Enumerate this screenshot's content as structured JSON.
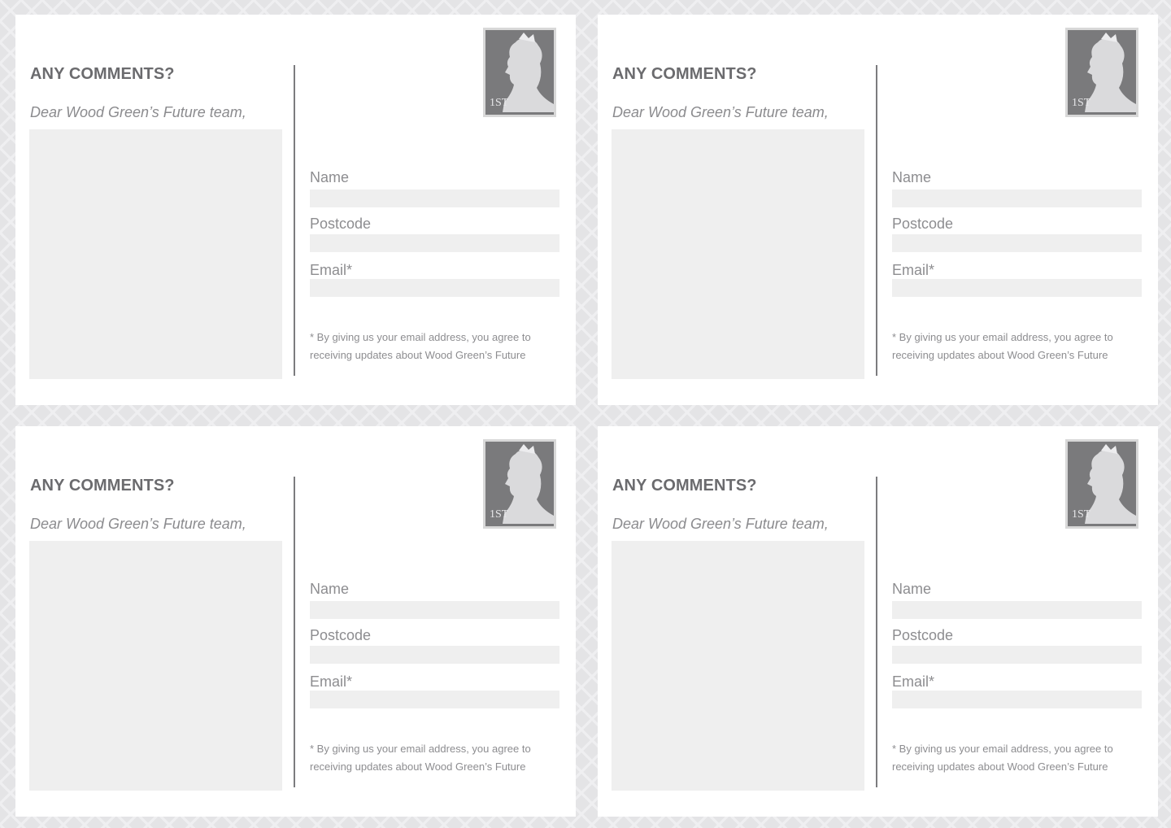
{
  "cards": [
    {
      "heading": "ANY COMMENTS?",
      "salutation": "Dear Wood Green’s Future team,",
      "stamp_icon": "first-class-stamp-icon",
      "fields": {
        "name": "Name",
        "postcode": "Postcode",
        "email": "Email*"
      },
      "disclaimer": "* By giving us your email address, you agree to receiving updates about Wood Green’s Future"
    },
    {
      "heading": "ANY COMMENTS?",
      "salutation": "Dear Wood Green’s Future team,",
      "stamp_icon": "first-class-stamp-icon",
      "fields": {
        "name": "Name",
        "postcode": "Postcode",
        "email": "Email*"
      },
      "disclaimer": "* By giving us your email address, you agree to receiving updates about Wood Green’s Future"
    },
    {
      "heading": "ANY COMMENTS?",
      "salutation": "Dear Wood Green’s Future team,",
      "stamp_icon": "first-class-stamp-icon",
      "fields": {
        "name": "Name",
        "postcode": "Postcode",
        "email": "Email*"
      },
      "disclaimer": "* By giving us your email address, you agree to receiving updates about Wood Green’s Future"
    },
    {
      "heading": "ANY COMMENTS?",
      "salutation": "Dear Wood Green’s Future team,",
      "stamp_icon": "first-class-stamp-icon",
      "fields": {
        "name": "Name",
        "postcode": "Postcode",
        "email": "Email*"
      },
      "disclaimer": "* By giving us your email address, you agree to receiving updates about Wood Green’s Future"
    }
  ],
  "stamp": {
    "value_text": "1ST"
  },
  "colors": {
    "background": "#e4e4e6",
    "card": "#ffffff",
    "field_fill": "#efefef",
    "heading_text": "#6b6b6e",
    "label_text": "#8d8d90",
    "divider": "#7b7b7e",
    "stamp": "#7a7a7c"
  }
}
